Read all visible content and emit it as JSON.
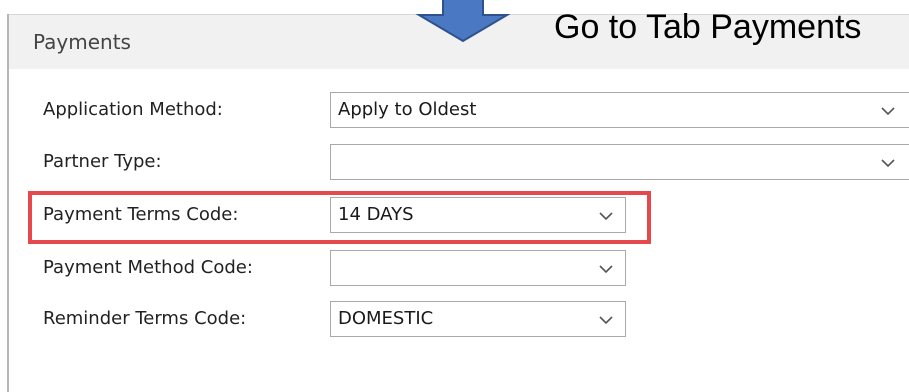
{
  "section": {
    "title": "Payments"
  },
  "annotation": {
    "text": "Go to Tab Payments"
  },
  "colors": {
    "arrow_fill": "#4a78c2",
    "arrow_stroke": "#2f528f",
    "highlight_border": "#e5484d",
    "header_background": "#f1f1f1"
  },
  "icons": {
    "arrow": "down-arrow-icon",
    "dropdown": "chevron-down-icon"
  },
  "fields": [
    {
      "label": "Application Method:",
      "value": "Apply to Oldest"
    },
    {
      "label": "Partner Type:",
      "value": ""
    },
    {
      "label": "Payment Terms Code:",
      "value": "14 DAYS"
    },
    {
      "label": "Payment Method Code:",
      "value": ""
    },
    {
      "label": "Reminder Terms Code:",
      "value": "DOMESTIC"
    }
  ]
}
